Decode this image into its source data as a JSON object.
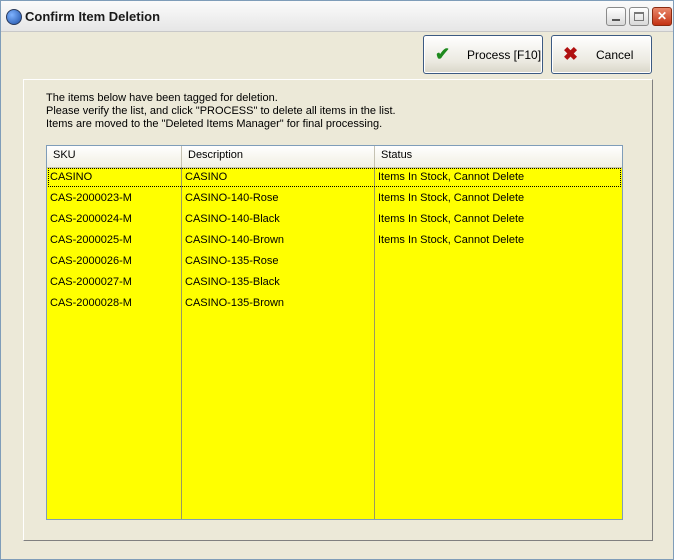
{
  "window": {
    "title": "Confirm Item Deletion"
  },
  "toolbar": {
    "process_label": "Process [F10]",
    "cancel_label": "Cancel"
  },
  "message": {
    "line1": "The items below have been tagged for deletion.",
    "line2": "Please verify the list, and click \"PROCESS\" to delete all items in the list.",
    "line3": "Items are moved to the \"Deleted Items Manager\" for final processing."
  },
  "grid": {
    "columns": [
      "SKU",
      "Description",
      "Status"
    ],
    "rows": [
      {
        "sku": "CASINO",
        "description": "CASINO",
        "status": "Items In Stock, Cannot Delete"
      },
      {
        "sku": "CAS-2000023-M",
        "description": "CASINO-140-Rose",
        "status": "Items In Stock, Cannot Delete"
      },
      {
        "sku": "CAS-2000024-M",
        "description": "CASINO-140-Black",
        "status": "Items In Stock, Cannot Delete"
      },
      {
        "sku": "CAS-2000025-M",
        "description": "CASINO-140-Brown",
        "status": "Items In Stock, Cannot Delete"
      },
      {
        "sku": "CAS-2000026-M",
        "description": "CASINO-135-Rose",
        "status": ""
      },
      {
        "sku": "CAS-2000027-M",
        "description": "CASINO-135-Black",
        "status": ""
      },
      {
        "sku": "CAS-2000028-M",
        "description": "CASINO-135-Brown",
        "status": ""
      }
    ],
    "row_color": "#ffff00"
  },
  "colors": {
    "process_icon": "#1e8a1e",
    "cancel_icon": "#b01010",
    "window_bg": "#ece9d8"
  },
  "icons": {
    "process": "checkmark-icon",
    "cancel": "x-icon"
  }
}
